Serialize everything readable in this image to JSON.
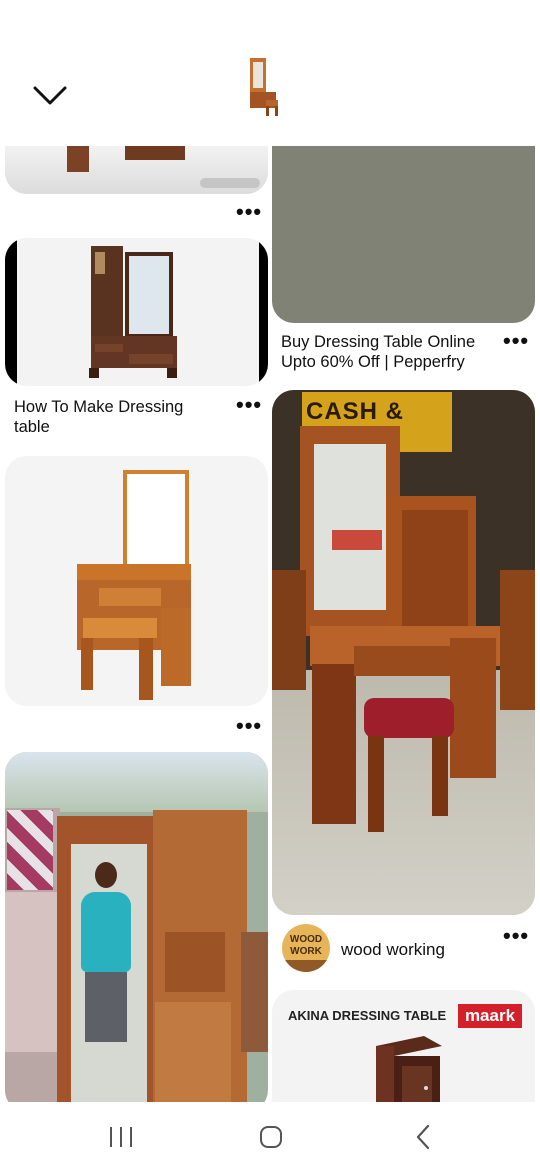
{
  "header": {
    "back_icon": "chevron-down-icon",
    "thumbnail": "dressing-table-thumbnail"
  },
  "pins": [
    {
      "id": "pin-1",
      "title": ""
    },
    {
      "id": "pin-2",
      "title": "Buy Dressing Table Online Upto 60% Off | Pepperfry"
    },
    {
      "id": "pin-3",
      "title": "How To Make Dressing table"
    },
    {
      "id": "pin-4",
      "title": ""
    },
    {
      "id": "pin-5",
      "title": ""
    },
    {
      "id": "pin-6",
      "title": ""
    },
    {
      "id": "pin-7",
      "title": ""
    }
  ],
  "board": {
    "logo_text": "WOOD WORK",
    "name": "wood working"
  },
  "ad": {
    "title": "AKINA DRESSING TABLE",
    "brand": "maark"
  },
  "photo_text": {
    "shop_sign": "CASH & CREDIT"
  },
  "navbar": {
    "recent_icon": "recent-apps-icon",
    "home_icon": "home-icon",
    "back_icon": "back-icon"
  },
  "colors": {
    "wood": "#b5652a",
    "wood_dark": "#7a3a16",
    "gray_card": "#7f8275",
    "brand_red": "#d4202a"
  }
}
